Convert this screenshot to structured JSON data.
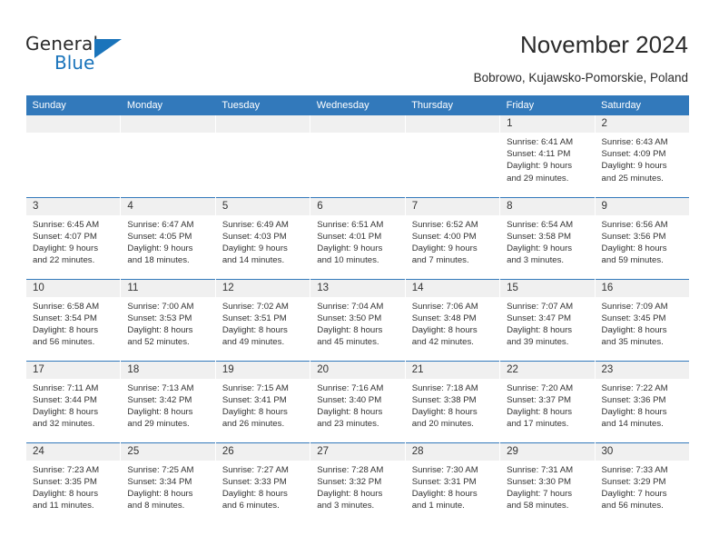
{
  "brand": {
    "name_top": "General",
    "name_bottom": "Blue",
    "accent_color": "#1a74bb"
  },
  "header": {
    "title": "November 2024",
    "subtitle": "Bobrowo, Kujawsko-Pomorskie, Poland"
  },
  "theme": {
    "header_row_bg": "#3279bb",
    "daynum_bg": "#f0f0f0",
    "row_divider": "#3279bb",
    "text_color": "#333333"
  },
  "weekday_headers": [
    "Sunday",
    "Monday",
    "Tuesday",
    "Wednesday",
    "Thursday",
    "Friday",
    "Saturday"
  ],
  "weeks": [
    [
      {
        "day": "",
        "sunrise": "",
        "sunset": "",
        "daylight_1": "",
        "daylight_2": ""
      },
      {
        "day": "",
        "sunrise": "",
        "sunset": "",
        "daylight_1": "",
        "daylight_2": ""
      },
      {
        "day": "",
        "sunrise": "",
        "sunset": "",
        "daylight_1": "",
        "daylight_2": ""
      },
      {
        "day": "",
        "sunrise": "",
        "sunset": "",
        "daylight_1": "",
        "daylight_2": ""
      },
      {
        "day": "",
        "sunrise": "",
        "sunset": "",
        "daylight_1": "",
        "daylight_2": ""
      },
      {
        "day": "1",
        "sunrise": "Sunrise: 6:41 AM",
        "sunset": "Sunset: 4:11 PM",
        "daylight_1": "Daylight: 9 hours",
        "daylight_2": "and 29 minutes."
      },
      {
        "day": "2",
        "sunrise": "Sunrise: 6:43 AM",
        "sunset": "Sunset: 4:09 PM",
        "daylight_1": "Daylight: 9 hours",
        "daylight_2": "and 25 minutes."
      }
    ],
    [
      {
        "day": "3",
        "sunrise": "Sunrise: 6:45 AM",
        "sunset": "Sunset: 4:07 PM",
        "daylight_1": "Daylight: 9 hours",
        "daylight_2": "and 22 minutes."
      },
      {
        "day": "4",
        "sunrise": "Sunrise: 6:47 AM",
        "sunset": "Sunset: 4:05 PM",
        "daylight_1": "Daylight: 9 hours",
        "daylight_2": "and 18 minutes."
      },
      {
        "day": "5",
        "sunrise": "Sunrise: 6:49 AM",
        "sunset": "Sunset: 4:03 PM",
        "daylight_1": "Daylight: 9 hours",
        "daylight_2": "and 14 minutes."
      },
      {
        "day": "6",
        "sunrise": "Sunrise: 6:51 AM",
        "sunset": "Sunset: 4:01 PM",
        "daylight_1": "Daylight: 9 hours",
        "daylight_2": "and 10 minutes."
      },
      {
        "day": "7",
        "sunrise": "Sunrise: 6:52 AM",
        "sunset": "Sunset: 4:00 PM",
        "daylight_1": "Daylight: 9 hours",
        "daylight_2": "and 7 minutes."
      },
      {
        "day": "8",
        "sunrise": "Sunrise: 6:54 AM",
        "sunset": "Sunset: 3:58 PM",
        "daylight_1": "Daylight: 9 hours",
        "daylight_2": "and 3 minutes."
      },
      {
        "day": "9",
        "sunrise": "Sunrise: 6:56 AM",
        "sunset": "Sunset: 3:56 PM",
        "daylight_1": "Daylight: 8 hours",
        "daylight_2": "and 59 minutes."
      }
    ],
    [
      {
        "day": "10",
        "sunrise": "Sunrise: 6:58 AM",
        "sunset": "Sunset: 3:54 PM",
        "daylight_1": "Daylight: 8 hours",
        "daylight_2": "and 56 minutes."
      },
      {
        "day": "11",
        "sunrise": "Sunrise: 7:00 AM",
        "sunset": "Sunset: 3:53 PM",
        "daylight_1": "Daylight: 8 hours",
        "daylight_2": "and 52 minutes."
      },
      {
        "day": "12",
        "sunrise": "Sunrise: 7:02 AM",
        "sunset": "Sunset: 3:51 PM",
        "daylight_1": "Daylight: 8 hours",
        "daylight_2": "and 49 minutes."
      },
      {
        "day": "13",
        "sunrise": "Sunrise: 7:04 AM",
        "sunset": "Sunset: 3:50 PM",
        "daylight_1": "Daylight: 8 hours",
        "daylight_2": "and 45 minutes."
      },
      {
        "day": "14",
        "sunrise": "Sunrise: 7:06 AM",
        "sunset": "Sunset: 3:48 PM",
        "daylight_1": "Daylight: 8 hours",
        "daylight_2": "and 42 minutes."
      },
      {
        "day": "15",
        "sunrise": "Sunrise: 7:07 AM",
        "sunset": "Sunset: 3:47 PM",
        "daylight_1": "Daylight: 8 hours",
        "daylight_2": "and 39 minutes."
      },
      {
        "day": "16",
        "sunrise": "Sunrise: 7:09 AM",
        "sunset": "Sunset: 3:45 PM",
        "daylight_1": "Daylight: 8 hours",
        "daylight_2": "and 35 minutes."
      }
    ],
    [
      {
        "day": "17",
        "sunrise": "Sunrise: 7:11 AM",
        "sunset": "Sunset: 3:44 PM",
        "daylight_1": "Daylight: 8 hours",
        "daylight_2": "and 32 minutes."
      },
      {
        "day": "18",
        "sunrise": "Sunrise: 7:13 AM",
        "sunset": "Sunset: 3:42 PM",
        "daylight_1": "Daylight: 8 hours",
        "daylight_2": "and 29 minutes."
      },
      {
        "day": "19",
        "sunrise": "Sunrise: 7:15 AM",
        "sunset": "Sunset: 3:41 PM",
        "daylight_1": "Daylight: 8 hours",
        "daylight_2": "and 26 minutes."
      },
      {
        "day": "20",
        "sunrise": "Sunrise: 7:16 AM",
        "sunset": "Sunset: 3:40 PM",
        "daylight_1": "Daylight: 8 hours",
        "daylight_2": "and 23 minutes."
      },
      {
        "day": "21",
        "sunrise": "Sunrise: 7:18 AM",
        "sunset": "Sunset: 3:38 PM",
        "daylight_1": "Daylight: 8 hours",
        "daylight_2": "and 20 minutes."
      },
      {
        "day": "22",
        "sunrise": "Sunrise: 7:20 AM",
        "sunset": "Sunset: 3:37 PM",
        "daylight_1": "Daylight: 8 hours",
        "daylight_2": "and 17 minutes."
      },
      {
        "day": "23",
        "sunrise": "Sunrise: 7:22 AM",
        "sunset": "Sunset: 3:36 PM",
        "daylight_1": "Daylight: 8 hours",
        "daylight_2": "and 14 minutes."
      }
    ],
    [
      {
        "day": "24",
        "sunrise": "Sunrise: 7:23 AM",
        "sunset": "Sunset: 3:35 PM",
        "daylight_1": "Daylight: 8 hours",
        "daylight_2": "and 11 minutes."
      },
      {
        "day": "25",
        "sunrise": "Sunrise: 7:25 AM",
        "sunset": "Sunset: 3:34 PM",
        "daylight_1": "Daylight: 8 hours",
        "daylight_2": "and 8 minutes."
      },
      {
        "day": "26",
        "sunrise": "Sunrise: 7:27 AM",
        "sunset": "Sunset: 3:33 PM",
        "daylight_1": "Daylight: 8 hours",
        "daylight_2": "and 6 minutes."
      },
      {
        "day": "27",
        "sunrise": "Sunrise: 7:28 AM",
        "sunset": "Sunset: 3:32 PM",
        "daylight_1": "Daylight: 8 hours",
        "daylight_2": "and 3 minutes."
      },
      {
        "day": "28",
        "sunrise": "Sunrise: 7:30 AM",
        "sunset": "Sunset: 3:31 PM",
        "daylight_1": "Daylight: 8 hours",
        "daylight_2": "and 1 minute."
      },
      {
        "day": "29",
        "sunrise": "Sunrise: 7:31 AM",
        "sunset": "Sunset: 3:30 PM",
        "daylight_1": "Daylight: 7 hours",
        "daylight_2": "and 58 minutes."
      },
      {
        "day": "30",
        "sunrise": "Sunrise: 7:33 AM",
        "sunset": "Sunset: 3:29 PM",
        "daylight_1": "Daylight: 7 hours",
        "daylight_2": "and 56 minutes."
      }
    ]
  ]
}
